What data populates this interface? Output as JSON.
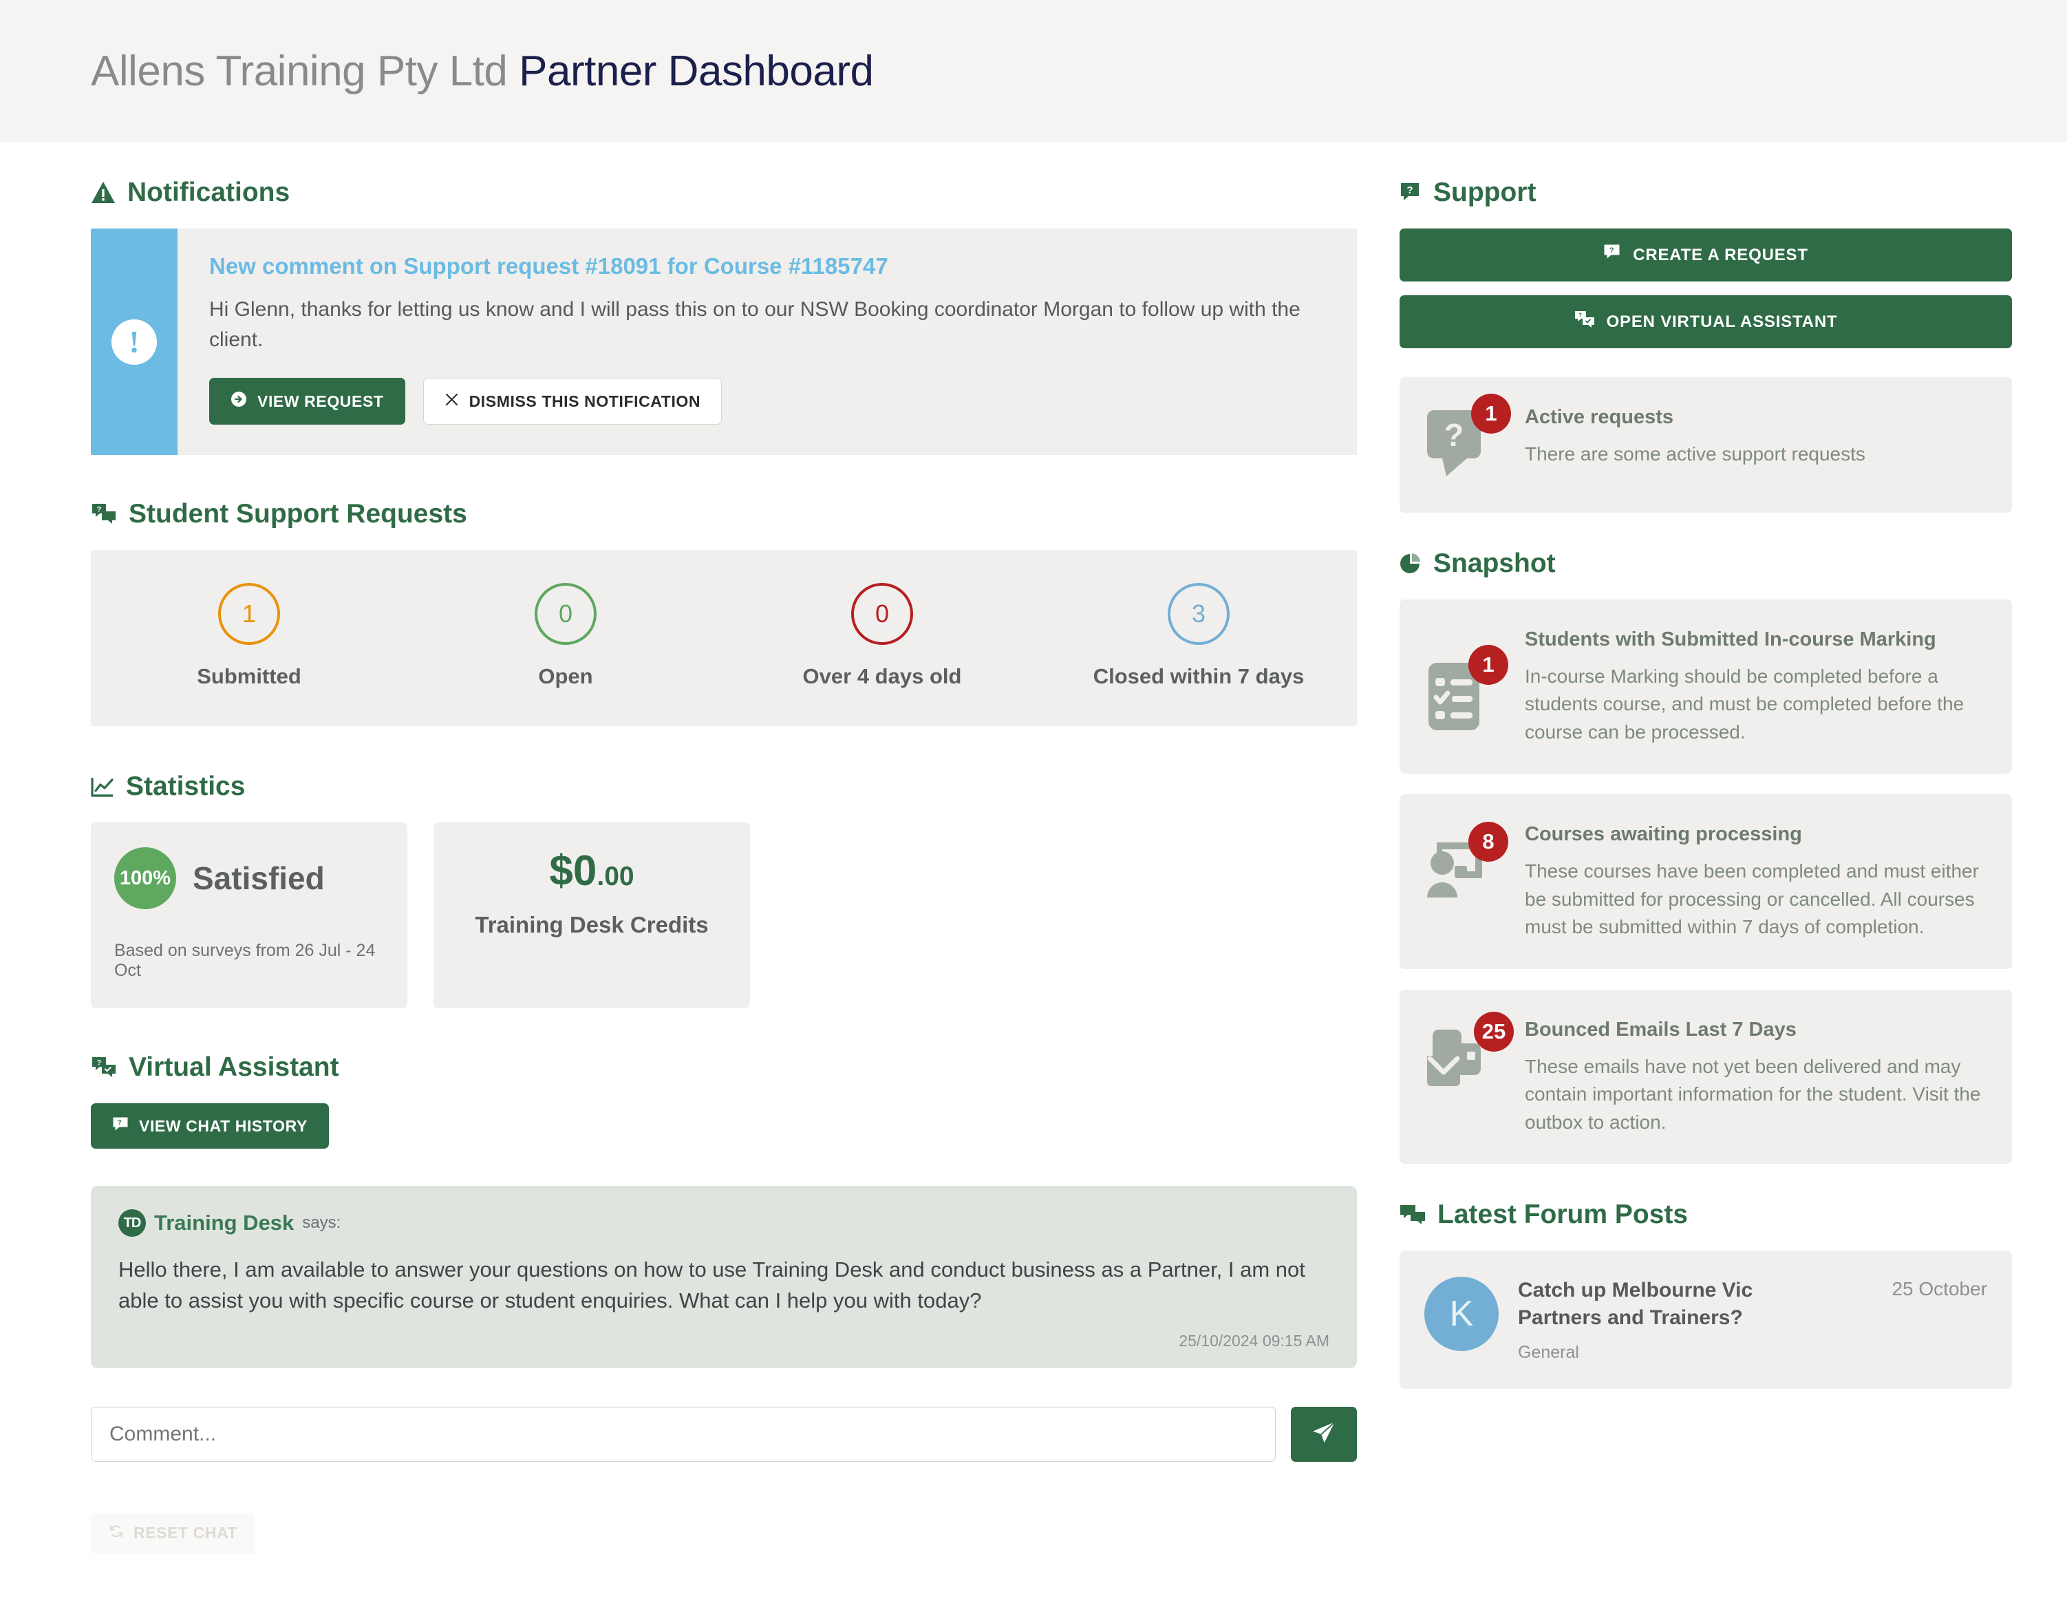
{
  "header": {
    "org": "Allens Training Pty Ltd",
    "title": "Partner Dashboard"
  },
  "notifications": {
    "heading": "Notifications",
    "item": {
      "title": "New comment on Support request #18091 for Course #1185747",
      "body": "Hi Glenn, thanks for letting us know and I will pass this on to our NSW Booking coordinator Morgan to follow up with the client.",
      "view_label": "VIEW REQUEST",
      "dismiss_label": "DISMISS THIS NOTIFICATION"
    }
  },
  "student_support": {
    "heading": "Student Support Requests",
    "stats": [
      {
        "value": "1",
        "label": "Submitted",
        "color": "#e8930c"
      },
      {
        "value": "0",
        "label": "Open",
        "color": "#5fa85f"
      },
      {
        "value": "0",
        "label": "Over 4 days old",
        "color": "#b72020"
      },
      {
        "value": "3",
        "label": "Closed within 7 days",
        "color": "#73aed4"
      }
    ]
  },
  "statistics": {
    "heading": "Statistics",
    "satisfaction": {
      "percent": "100%",
      "word": "Satisfied",
      "sub": "Based on surveys from 26 Jul - 24 Oct"
    },
    "credits": {
      "amount_major": "$0",
      "amount_minor": ".00",
      "label": "Training Desk Credits"
    }
  },
  "virtual_assistant": {
    "heading": "Virtual Assistant",
    "history_label": "VIEW CHAT HISTORY",
    "message": {
      "logo": "TD",
      "author": "Training Desk",
      "says": "says:",
      "text": "Hello there, I am available to answer your questions on how to use Training Desk and conduct business as a Partner, I am not able to assist you with specific course or student enquiries. What can I help you with today?",
      "time": "25/10/2024 09:15 AM"
    },
    "input_placeholder": "Comment...",
    "reset_label": "RESET CHAT"
  },
  "support": {
    "heading": "Support",
    "create_label": "CREATE A REQUEST",
    "assistant_label": "OPEN VIRTUAL ASSISTANT",
    "active": {
      "badge": "1",
      "title": "Active requests",
      "desc": "There are some active support requests"
    }
  },
  "snapshot": {
    "heading": "Snapshot",
    "cards": [
      {
        "badge": "1",
        "title": "Students with Submitted In-course Marking",
        "desc": "In-course Marking should be completed before a students course, and must be completed before the course can be processed.",
        "icon": "checklist-icon"
      },
      {
        "badge": "8",
        "title": "Courses awaiting processing",
        "desc": "These courses have been completed and must either be submitted for processing or cancelled. All courses must be submitted within 7 days of completion.",
        "icon": "presentation-person-icon"
      },
      {
        "badge": "25",
        "title": "Bounced Emails Last 7 Days",
        "desc": "These emails have not yet been delivered and may contain important information for the student. Visit the outbox to action.",
        "icon": "envelopes-icon"
      }
    ]
  },
  "forum": {
    "heading": "Latest Forum Posts",
    "posts": [
      {
        "initial": "K",
        "title": "Catch up Melbourne Vic Partners and Trainers?",
        "category": "General",
        "date": "25 October"
      }
    ]
  }
}
